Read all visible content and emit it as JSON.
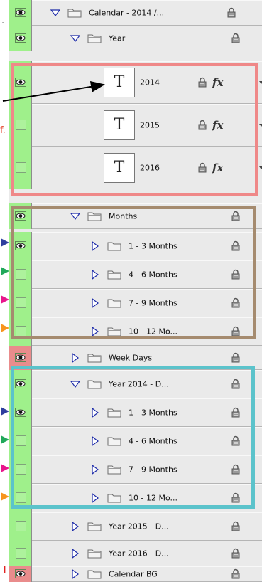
{
  "colors": {
    "visible_col": "#9ff08b",
    "red_col": "#e98c8c",
    "frame_year": "#ef8888",
    "frame_months": "#a58b6f",
    "frame_year2014": "#5bc3cb",
    "arrow_blue": "#2e3e9e",
    "arrow_green": "#21a85a",
    "arrow_pink": "#e8168c",
    "arrow_orange": "#f7941d",
    "edge_text": "#e8523c"
  },
  "edge_text": {
    "top": ".",
    "mid": "f.",
    "bottom": "l"
  },
  "layers": [
    {
      "name": "Calendar - 2014 /...",
      "type": "group",
      "indent": 0,
      "expanded": true,
      "eye": true
    },
    {
      "name": "Year",
      "type": "group",
      "indent": 1,
      "expanded": true,
      "eye": true
    },
    {
      "name": "2014",
      "type": "text",
      "eye": true,
      "fx": "fx"
    },
    {
      "name": "2015",
      "type": "text",
      "eye": false,
      "fx": "fx"
    },
    {
      "name": "2016",
      "type": "text",
      "eye": false,
      "fx": "fx"
    },
    {
      "name": "Months",
      "type": "group",
      "indent": 1,
      "expanded": true,
      "eye": true
    },
    {
      "name": "1 - 3 Months",
      "type": "group",
      "indent": 2,
      "expanded": false,
      "eye": true
    },
    {
      "name": "4 - 6 Months",
      "type": "group",
      "indent": 2,
      "expanded": false,
      "eye": false
    },
    {
      "name": "7 - 9 Months",
      "type": "group",
      "indent": 2,
      "expanded": false,
      "eye": false
    },
    {
      "name": "10 - 12 Mo...",
      "type": "group",
      "indent": 2,
      "expanded": false,
      "eye": false
    },
    {
      "name": "Week Days",
      "type": "group",
      "indent": 1,
      "expanded": false,
      "eye": true,
      "red": true
    },
    {
      "name": "Year 2014 - D...",
      "type": "group",
      "indent": 1,
      "expanded": true,
      "eye": true
    },
    {
      "name": "1 - 3 Months",
      "type": "group",
      "indent": 2,
      "expanded": false,
      "eye": true
    },
    {
      "name": "4 - 6 Months",
      "type": "group",
      "indent": 2,
      "expanded": false,
      "eye": false
    },
    {
      "name": "7 - 9 Months",
      "type": "group",
      "indent": 2,
      "expanded": false,
      "eye": false
    },
    {
      "name": "10 - 12 Mo...",
      "type": "group",
      "indent": 2,
      "expanded": false,
      "eye": false
    },
    {
      "name": "Year 2015 - D...",
      "type": "group",
      "indent": 1,
      "expanded": false,
      "eye": false
    },
    {
      "name": "Year 2016 - D...",
      "type": "group",
      "indent": 1,
      "expanded": false,
      "eye": false
    },
    {
      "name": "Calendar BG",
      "type": "group",
      "indent": 1,
      "expanded": false,
      "eye": true,
      "red": true
    }
  ]
}
